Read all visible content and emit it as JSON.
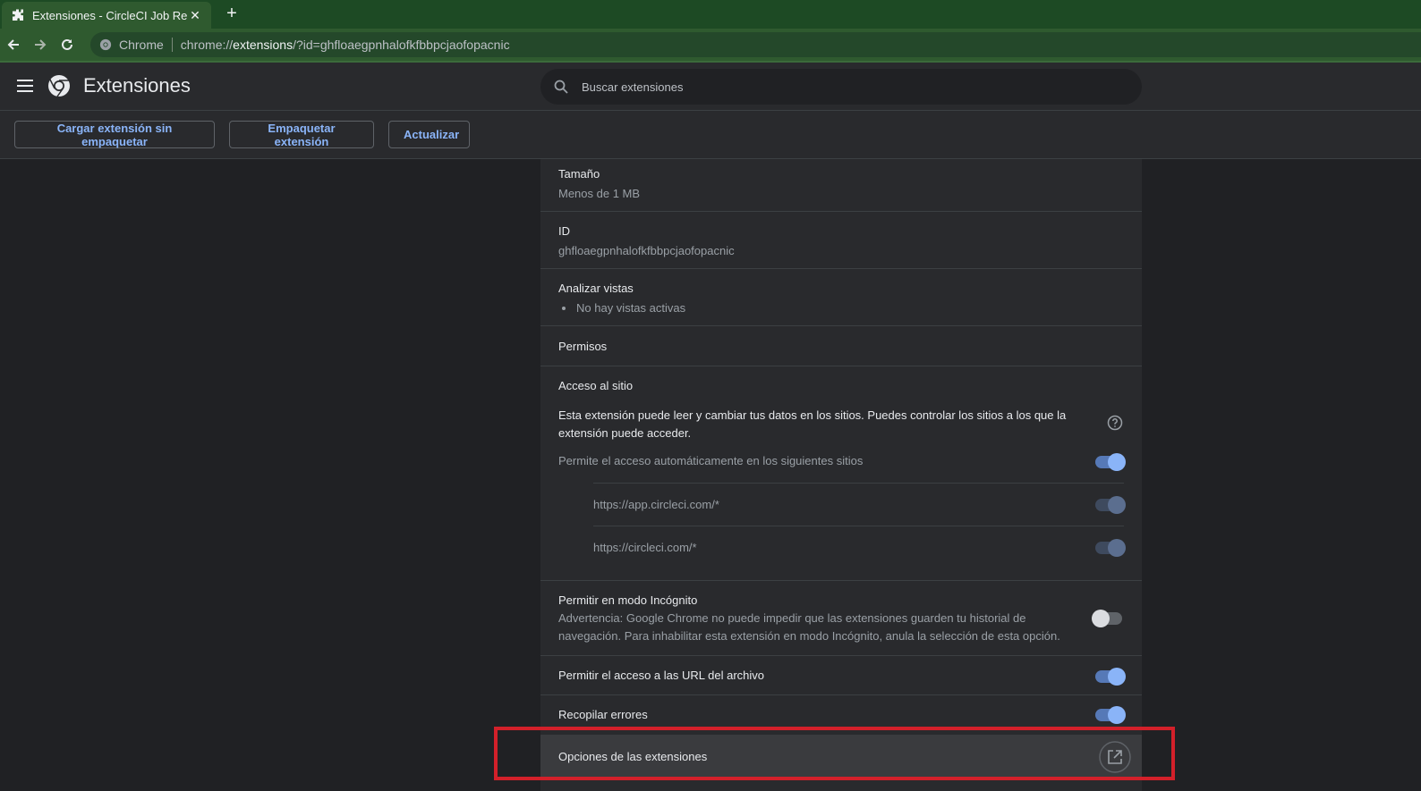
{
  "browser": {
    "tab_title": "Extensiones - CircleCI Job Rerun",
    "tab_close": "✕",
    "new_tab": "+",
    "chip_label": "Chrome",
    "url_scheme": "chrome://",
    "url_host": "extensions",
    "url_rest": "/?id=ghfloaegpnhalofkfbbpcjaofopacnic"
  },
  "header": {
    "title": "Extensiones",
    "search_placeholder": "Buscar extensiones"
  },
  "dev_toolbar": {
    "load_unpacked": "Cargar extensión sin empaquetar",
    "pack": "Empaquetar extensión",
    "update": "Actualizar"
  },
  "details": {
    "size_title": "Tamaño",
    "size_value": "Menos de 1 MB",
    "id_title": "ID",
    "id_value": "ghfloaegpnhalofkfbbpcjaofopacnic",
    "views_title": "Analizar vistas",
    "views_item": "No hay vistas activas",
    "permissions_title": "Permisos",
    "site_access_title": "Acceso al sitio",
    "site_access_desc_line1": "Esta extensión puede leer y cambiar tus datos en los sitios. Puedes controlar los sitios a los que la",
    "site_access_desc_line2": "extensión puede acceder.",
    "auto_access_label": "Permite el acceso automáticamente en los siguientes sitios",
    "sites": [
      "https://app.circleci.com/*",
      "https://circleci.com/*"
    ],
    "incognito_title": "Permitir en modo Incógnito",
    "incognito_desc_line1": "Advertencia: Google Chrome no puede impedir que las extensiones guarden tu historial de",
    "incognito_desc_line2": "navegación. Para inhabilitar esta extensión en modo Incógnito, anula la selección de esta opción.",
    "file_urls_title": "Permitir el acceso a las URL del archivo",
    "collect_errors_title": "Recopilar errores",
    "options_title": "Opciones de las extensiones"
  },
  "toggles": {
    "auto_access": true,
    "site_0": true,
    "site_1": true,
    "incognito": false,
    "file_urls": true,
    "collect_errors": true
  },
  "colors": {
    "accent": "#8ab4f8",
    "highlight_box": "#d3202a",
    "browser_frame": "#2f5a2f"
  }
}
